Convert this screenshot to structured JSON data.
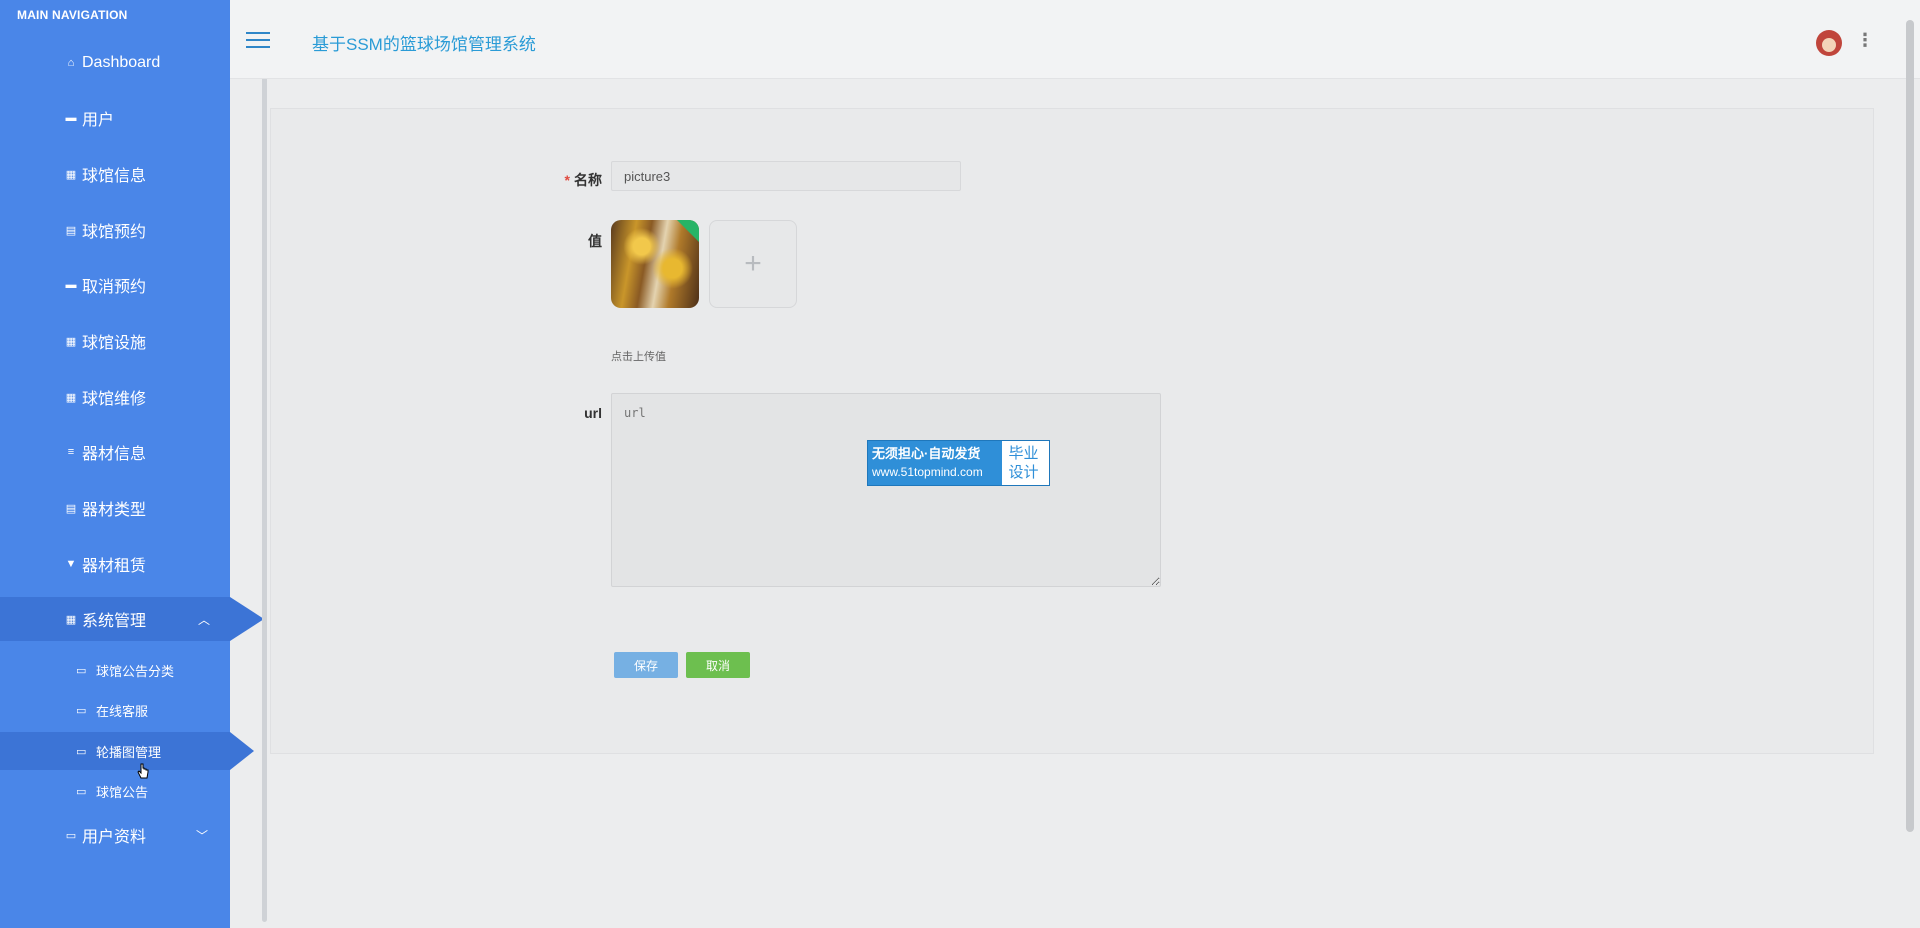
{
  "sidebar": {
    "title": "MAIN NAVIGATION",
    "items": [
      {
        "label": "Dashboard",
        "icon": "home-icon"
      },
      {
        "label": "用户",
        "icon": "chat-icon"
      },
      {
        "label": "球馆信息",
        "icon": "grid-icon"
      },
      {
        "label": "球馆预约",
        "icon": "clipboard-icon"
      },
      {
        "label": "取消预约",
        "icon": "briefcase-icon"
      },
      {
        "label": "球馆设施",
        "icon": "grid-icon"
      },
      {
        "label": "球馆维修",
        "icon": "grid-icon"
      },
      {
        "label": "器材信息",
        "icon": "list-icon"
      },
      {
        "label": "器材类型",
        "icon": "clipboard-icon"
      },
      {
        "label": "器材租赁",
        "icon": "download-icon"
      },
      {
        "label": "系统管理",
        "icon": "grid-icon",
        "expanded": true
      },
      {
        "label": "用户资料",
        "icon": "card-icon",
        "expanded": false
      }
    ],
    "sub_items": [
      {
        "label": "球馆公告分类",
        "icon": "folder-icon"
      },
      {
        "label": "在线客服",
        "icon": "folder-icon"
      },
      {
        "label": "轮播图管理",
        "icon": "folder-icon",
        "active": true
      },
      {
        "label": "球馆公告",
        "icon": "folder-icon"
      }
    ]
  },
  "header": {
    "title": "基于SSM的篮球场馆管理系统"
  },
  "form": {
    "name_label": "名称",
    "name_required": "*",
    "name_value": "picture3",
    "value_label": "值",
    "upload_plus": "+",
    "upload_hint": "点击上传值",
    "url_label": "url",
    "url_placeholder": "url",
    "save_label": "保存",
    "cancel_label": "取消"
  },
  "watermark": {
    "line1": "无须担心·自动发货",
    "line2": "www.51topmind.com",
    "right_line1": "毕业",
    "right_line2": "设计"
  },
  "colors": {
    "sidebar_bg": "#4a86e8",
    "sidebar_active": "#3c74d6",
    "title_color": "#2a9bd6",
    "save_button": "#76b0e3",
    "cancel_button": "#6dbf4f"
  }
}
